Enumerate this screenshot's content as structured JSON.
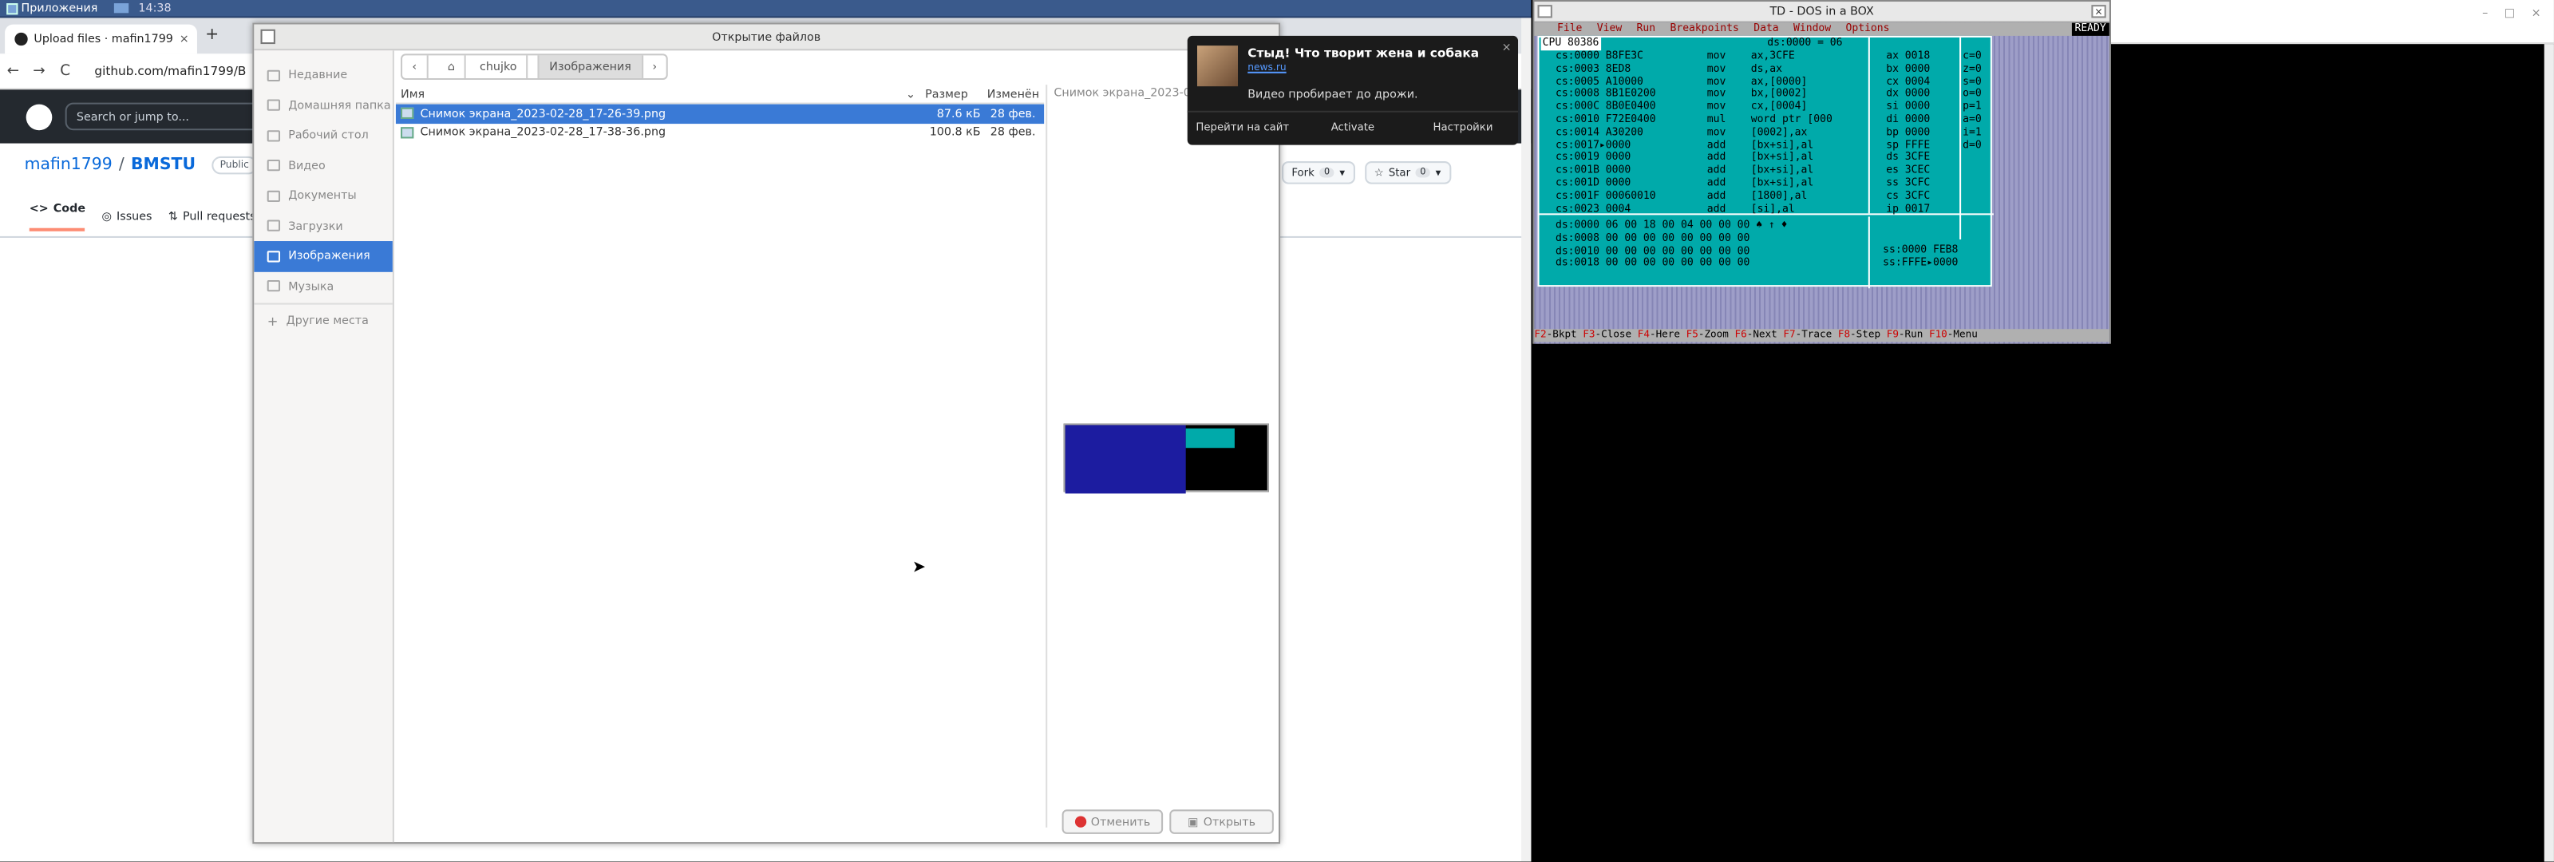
{
  "taskbar": {
    "apps_label": "Приложения",
    "clock": "14:38"
  },
  "browser": {
    "tab_title": "Upload files · mafin1799/BMSTU",
    "tab_close": "×",
    "new_tab": "+",
    "back": "←",
    "forward": "→",
    "reload": "C",
    "url": "github.com/mafin1799/B",
    "search_placeholder": "Search or jump to...",
    "repo_owner": "mafin1799",
    "repo_slash": "/",
    "repo_name": "BMSTU",
    "repo_visibility": "Public",
    "nav": {
      "code": "Code",
      "issues": "Issues",
      "pulls": "Pull requests"
    },
    "fork_label": "Fork",
    "fork_count": "0",
    "star_label": "Star",
    "star_count": "0"
  },
  "dialog": {
    "title": "Открытие файлов",
    "path": {
      "back": "‹",
      "home": "chujko",
      "current": "Изображения",
      "forward": "›"
    },
    "sidebar": [
      {
        "label": "Недавние"
      },
      {
        "label": "Домашняя папка"
      },
      {
        "label": "Рабочий стол"
      },
      {
        "label": "Видео"
      },
      {
        "label": "Документы"
      },
      {
        "label": "Загрузки"
      },
      {
        "label": "Изображения"
      },
      {
        "label": "Музыка"
      },
      {
        "label": "Другие места"
      }
    ],
    "columns": {
      "name": "Имя",
      "size": "Размер",
      "modified": "Изменён"
    },
    "files": [
      {
        "name": "Снимок экрана_2023-02-28_17-26-39.png",
        "size": "87.6 кБ",
        "modified": "28 фев."
      },
      {
        "name": "Снимок экрана_2023-02-28_17-38-36.png",
        "size": "100.8 кБ",
        "modified": "28 фев."
      }
    ],
    "preview_name": "Снимок экрана_2023-02",
    "cancel": "Отменить",
    "open": "Открыть"
  },
  "notification": {
    "title": "Стыд! Что творит жена и собака",
    "link": "news.ru",
    "body": "Видео пробирает до дрожи.",
    "actions": [
      "Перейти на сайт",
      "Activate",
      "Настройки"
    ],
    "close": "×"
  },
  "dosbox": {
    "title": "TD - DOS in a BOX",
    "menu": [
      "File",
      "View",
      "Run",
      "Breakpoints",
      "Data",
      "Window",
      "Options"
    ],
    "status": "READY",
    "cpu_title": "CPU 80386",
    "cpu_ds": "ds:0000 = 06",
    "code_addr": "cs:0000 B8FE3C\ncs:0003 8ED8\ncs:0005 A10000\ncs:0008 8B1E0200\ncs:000C 8B0E0400\ncs:0010 F72E0400\ncs:0014 A30200\ncs:0017▸0000\ncs:0019 0000\ncs:001B 0000\ncs:001D 0000\ncs:001F 00060010\ncs:0023 0004",
    "code_instr": "mov    ax,3CFE\nmov    ds,ax\nmov    ax,[0000]\nmov    bx,[0002]\nmov    cx,[0004]\nmul    word ptr [000\nmov    [0002],ax\nadd    [bx+si],al\nadd    [bx+si],al\nadd    [bx+si],al\nadd    [bx+si],al\nadd    [1800],al\nadd    [si],al",
    "regs": "ax 0018\nbx 0000\ncx 0004\ndx 0000\nsi 0000\ndi 0000\nbp 0000\nsp FFFE\nds 3CFE\nes 3CEC\nss 3CFC\ncs 3CFC\nip 0017",
    "flags": "c=0\nz=0\ns=0\no=0\np=1\na=0\ni=1\nd=0",
    "dump": "ds:0000 06 00 18 00 04 00 00 00 ♠ ↑ ♦\nds:0008 00 00 00 00 00 00 00 00\nds:0010 00 00 00 00 00 00 00 00\nds:0018 00 00 00 00 00 00 00 00",
    "stack": "ss:0000 FEB8\nss:FFFE▸0000",
    "fkeys": [
      {
        "k": "F2",
        "t": "-Bkpt"
      },
      {
        "k": "F3",
        "t": "-Close"
      },
      {
        "k": "F4",
        "t": "-Here"
      },
      {
        "k": "F5",
        "t": "-Zoom"
      },
      {
        "k": "F6",
        "t": "-Next"
      },
      {
        "k": "F7",
        "t": "-Trace"
      },
      {
        "k": "F8",
        "t": "-Step"
      },
      {
        "k": "F9",
        "t": "-Run"
      },
      {
        "k": "F10",
        "t": "-Menu"
      }
    ]
  }
}
